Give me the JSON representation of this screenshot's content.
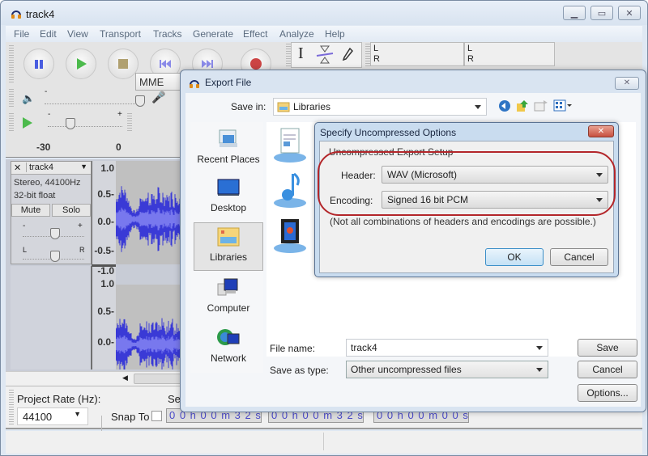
{
  "app": {
    "title": "track4",
    "window_controls": [
      "minimize",
      "maximize",
      "close"
    ]
  },
  "menu": [
    "File",
    "Edit",
    "View",
    "Transport",
    "Tracks",
    "Generate",
    "Effect",
    "Analyze",
    "Help"
  ],
  "transport": {
    "buttons": [
      "pause",
      "play",
      "stop",
      "skip-to-start",
      "skip-to-end",
      "record"
    ]
  },
  "tools": [
    "selection-tool",
    "envelope-tool",
    "draw-tool"
  ],
  "meters": {
    "left_label": "L",
    "right_label": "R"
  },
  "mixer": {
    "minus": "-",
    "plus": "+",
    "device": "MME"
  },
  "ruler": {
    "ticks": [
      "-30",
      "0"
    ]
  },
  "track": {
    "name": "track4",
    "format": "Stereo, 44100Hz",
    "bit_depth": "32-bit float",
    "mute_label": "Mute",
    "solo_label": "Solo",
    "gain_minus": "-",
    "gain_plus": "+",
    "pan_left": "L",
    "pan_right": "R",
    "scale_top": [
      "1.0",
      "0.5-",
      "0.0-",
      "-0.5-",
      "-1.0"
    ],
    "scale_bottom": [
      "1.0",
      "0.5-",
      "0.0-"
    ]
  },
  "bottom": {
    "project_rate_label": "Project Rate (Hz):",
    "project_rate_value": "44100",
    "snap_to_label": "Snap To",
    "selection_label": "Sel",
    "time1": "0 0 h 0 0 m 3 2 s",
    "time2": "0 0 h 0 0 m 3 2 s",
    "time3": "0 0 h 0 0 m 0 0 s"
  },
  "export": {
    "title": "Export File",
    "save_in_label": "Save in:",
    "save_in_value": "Libraries",
    "places": [
      "Recent Places",
      "Desktop",
      "Libraries",
      "Computer",
      "Network"
    ],
    "selected_place": "Libraries",
    "file_name_label": "File name:",
    "file_name_value": "track4",
    "save_as_type_label": "Save as type:",
    "save_as_type_value": "Other uncompressed files",
    "save_button": "Save",
    "cancel_button": "Cancel",
    "options_button": "Options..."
  },
  "options_dialog": {
    "title": "Specify Uncompressed Options",
    "group_label": "Uncompressed Export Setup",
    "header_label": "Header:",
    "header_value": "WAV (Microsoft)",
    "encoding_label": "Encoding:",
    "encoding_value": "Signed 16 bit PCM",
    "note": "(Not all combinations of headers and encodings are possible.)",
    "ok_button": "OK",
    "cancel_button": "Cancel"
  },
  "colors": {
    "waveform": "#3a3ad6",
    "waveform_rms": "#7878ee",
    "highlight": "#b3262a",
    "play_green": "#4cba4c",
    "pause_blue": "#4a5ee0"
  }
}
